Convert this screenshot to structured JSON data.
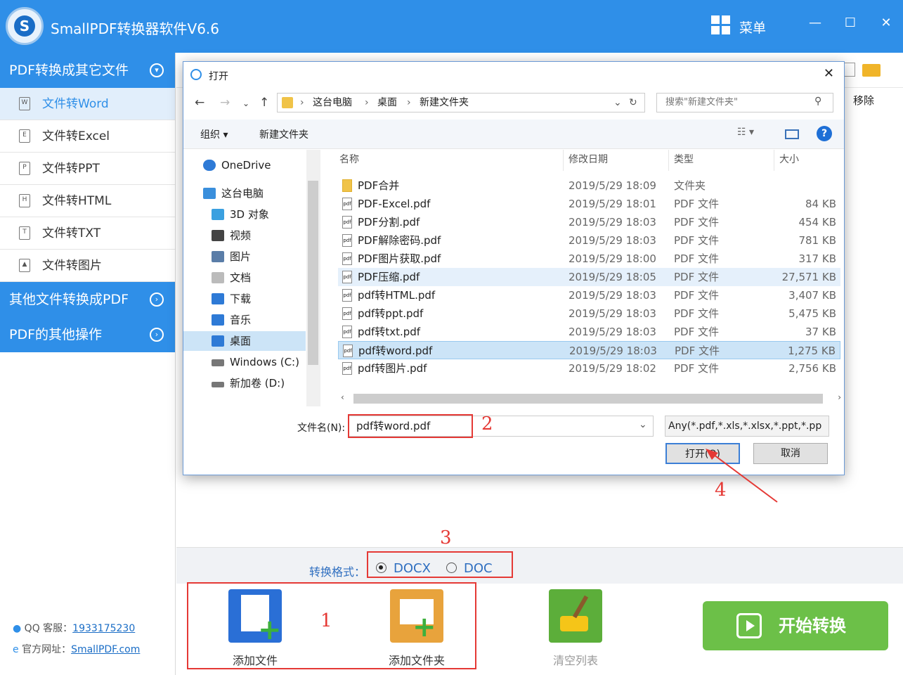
{
  "app": {
    "title": "SmallPDF转换器软件V6.6",
    "logo_letter": "S",
    "menu_label": "菜单"
  },
  "sidebar": {
    "sections": [
      {
        "label": "PDF转换成其它文件",
        "icon": "chevron-down-circle-icon"
      },
      {
        "label": "其他文件转换成PDF",
        "icon": "chevron-right-circle-icon"
      },
      {
        "label": "PDF的其他操作",
        "icon": "chevron-right-circle-icon"
      }
    ],
    "items": [
      {
        "label": "文件转Word",
        "glyph": "W"
      },
      {
        "label": "文件转Excel",
        "glyph": "E"
      },
      {
        "label": "文件转PPT",
        "glyph": "P"
      },
      {
        "label": "文件转HTML",
        "glyph": "H"
      },
      {
        "label": "文件转TXT",
        "glyph": "T"
      },
      {
        "label": "文件转图片",
        "glyph": "▲"
      }
    ],
    "support": {
      "qq_label": "QQ 客服：",
      "qq_value": "1933175230",
      "site_label": "官方网址：",
      "site_value": "SmallPDF.com"
    }
  },
  "main": {
    "remove_label": "移除"
  },
  "format": {
    "label": "转换格式：",
    "options": [
      "DOCX",
      "DOC"
    ],
    "selected": "DOCX"
  },
  "tools": {
    "add_file": "添加文件",
    "add_folder": "添加文件夹",
    "clear_list": "清空列表",
    "start": "开始转换"
  },
  "annotations": [
    "1",
    "2",
    "3",
    "4"
  ],
  "dialog": {
    "title": "打开",
    "path": [
      "这台电脑",
      "桌面",
      "新建文件夹"
    ],
    "search_placeholder": "搜索\"新建文件夹\"",
    "organize": "组织 ▾",
    "new_folder": "新建文件夹",
    "nav_items": [
      {
        "label": "OneDrive",
        "color": "#2e7ad6"
      },
      {
        "label": "这台电脑",
        "color": "#3a8fdc"
      },
      {
        "label": "3D 对象",
        "color": "#3aa0e0"
      },
      {
        "label": "视频",
        "color": "#444"
      },
      {
        "label": "图片",
        "color": "#5a7da8"
      },
      {
        "label": "文档",
        "color": "#888"
      },
      {
        "label": "下载",
        "color": "#2e7ad6"
      },
      {
        "label": "音乐",
        "color": "#2e7ad6"
      },
      {
        "label": "桌面",
        "color": "#2e7ad6"
      },
      {
        "label": "Windows (C:)",
        "color": "#777"
      },
      {
        "label": "新加卷 (D:)",
        "color": "#777"
      }
    ],
    "columns": {
      "name": "名称",
      "date": "修改日期",
      "type": "类型",
      "size": "大小"
    },
    "files": [
      {
        "name": "PDF合并",
        "date": "2019/5/29 18:09",
        "type": "文件夹",
        "size": ""
      },
      {
        "name": "PDF-Excel.pdf",
        "date": "2019/5/29 18:01",
        "type": "PDF 文件",
        "size": "84 KB"
      },
      {
        "name": "PDF分割.pdf",
        "date": "2019/5/29 18:03",
        "type": "PDF 文件",
        "size": "454 KB"
      },
      {
        "name": "PDF解除密码.pdf",
        "date": "2019/5/29 18:03",
        "type": "PDF 文件",
        "size": "781 KB"
      },
      {
        "name": "PDF图片获取.pdf",
        "date": "2019/5/29 18:00",
        "type": "PDF 文件",
        "size": "317 KB"
      },
      {
        "name": "PDF压缩.pdf",
        "date": "2019/5/29 18:05",
        "type": "PDF 文件",
        "size": "27,571 KB"
      },
      {
        "name": "pdf转HTML.pdf",
        "date": "2019/5/29 18:03",
        "type": "PDF 文件",
        "size": "3,407 KB"
      },
      {
        "name": "pdf转ppt.pdf",
        "date": "2019/5/29 18:03",
        "type": "PDF 文件",
        "size": "5,475 KB"
      },
      {
        "name": "pdf转txt.pdf",
        "date": "2019/5/29 18:03",
        "type": "PDF 文件",
        "size": "37 KB"
      },
      {
        "name": "pdf转word.pdf",
        "date": "2019/5/29 18:03",
        "type": "PDF 文件",
        "size": "1,275 KB"
      },
      {
        "name": "pdf转图片.pdf",
        "date": "2019/5/29 18:02",
        "type": "PDF 文件",
        "size": "2,756 KB"
      }
    ],
    "filename_label": "文件名(N):",
    "filename_value": "pdf转word.pdf",
    "filter_value": "Any(*.pdf,*.xls,*.xlsx,*.ppt,*.pp",
    "open_label": "打开(O)",
    "cancel_label": "取消"
  }
}
